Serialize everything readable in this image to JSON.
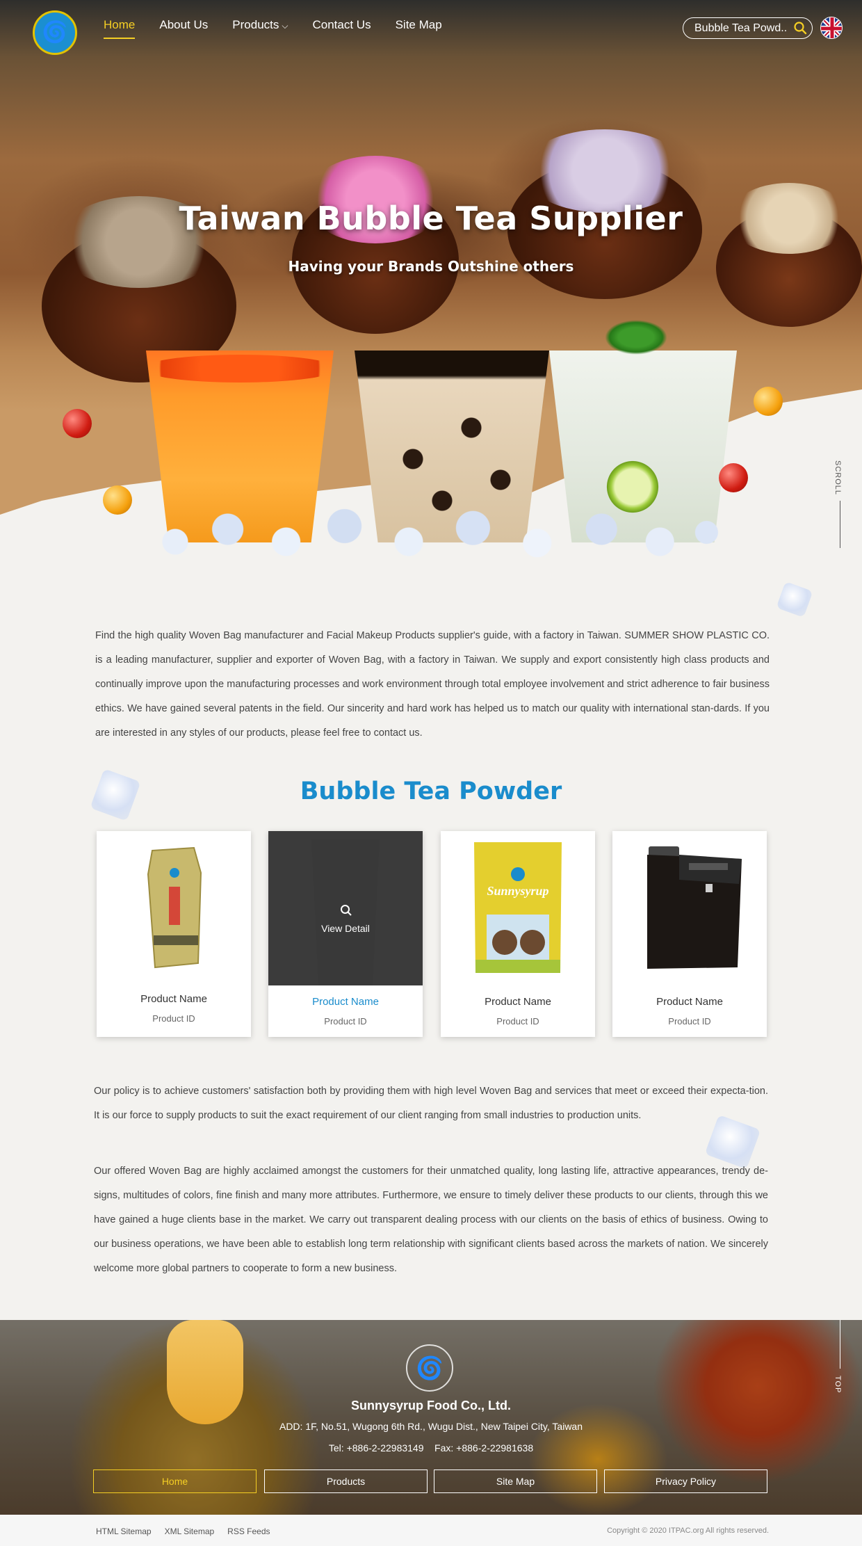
{
  "header": {
    "nav": [
      {
        "label": "Home",
        "active": true
      },
      {
        "label": "About Us"
      },
      {
        "label": "Products",
        "has_dropdown": true
      },
      {
        "label": "Contact Us"
      },
      {
        "label": "Site Map"
      }
    ],
    "search_value": "Bubble Tea Powd..",
    "language_icon": "uk-flag-icon"
  },
  "hero": {
    "title": "Taiwan Bubble Tea Supplier",
    "subtitle": "Having your Brands Outshine others",
    "scroll_label": "SCROLL"
  },
  "intro": {
    "text": "Find the high quality Woven Bag manufacturer and Facial Makeup Products supplier's guide, with a factory in Taiwan. SUMMER SHOW PLASTIC CO. is a leading manufacturer, supplier and exporter of Woven Bag, with a factory in Taiwan. We supply and export consistently high class products and continually improve upon the manufacturing processes and work environment through total employee involvement and strict adherence to fair business ethics. We have gained several patents in the field. Our sincerity and hard work has helped us to match our quality with international stan-dards. If you are interested in any styles of our products, please feel free to contact us."
  },
  "products": {
    "title": "Bubble Tea Powder",
    "items": [
      {
        "name": "Product Name",
        "id": "Product ID",
        "image": "black-tea-bag"
      },
      {
        "name": "Product Name",
        "id": "Product ID",
        "image": "black-cup",
        "hover_label": "View Detail"
      },
      {
        "name": "Product Name",
        "id": "Product ID",
        "image": "sunnysyrup-pouch",
        "brand_text": "Sunnysyrup"
      },
      {
        "name": "Product Name",
        "id": "Product ID",
        "image": "syrup-dispenser-machine"
      }
    ]
  },
  "policy": {
    "p1": "Our policy is to achieve customers' satisfaction both by providing them with high level Woven Bag and services that meet or exceed their expecta-tion. It is our force to supply products to suit the exact requirement of our client ranging from small industries to production units.",
    "p2": "Our offered Woven Bag are highly acclaimed amongst the customers for their unmatched quality, long lasting life, attractive appearances, trendy de-signs, multitudes of colors, fine finish and many more attributes. Furthermore, we ensure to timely deliver these products to our clients, through this we have gained a huge clients base in the market. We carry out transparent dealing process with our clients on the basis of ethics of business. Owing to our business operations, we have been able to establish long term relationship with significant clients based across the markets of nation. We sincerely welcome more global partners to cooperate to form a new business."
  },
  "footer": {
    "company": "Sunnysyrup Food Co., Ltd.",
    "address": "ADD: 1F, No.51, Wugong 6th Rd., Wugu Dist., New Taipei City, Taiwan",
    "contact": "Tel: +886-2-22983149    Fax: +886-2-22981638",
    "links": [
      {
        "label": "Home",
        "active": true
      },
      {
        "label": "Products"
      },
      {
        "label": "Site Map"
      },
      {
        "label": "Privacy Policy"
      }
    ],
    "top_label": "TOP",
    "bottom_links": [
      "HTML Sitemap",
      "XML Sitemap",
      "RSS Feeds"
    ],
    "copyright": "Copyright © 2020 ITPAC.org All rights reserved."
  },
  "colors": {
    "accent_blue": "#1a8ccc",
    "nav_active": "#f5cf24"
  }
}
